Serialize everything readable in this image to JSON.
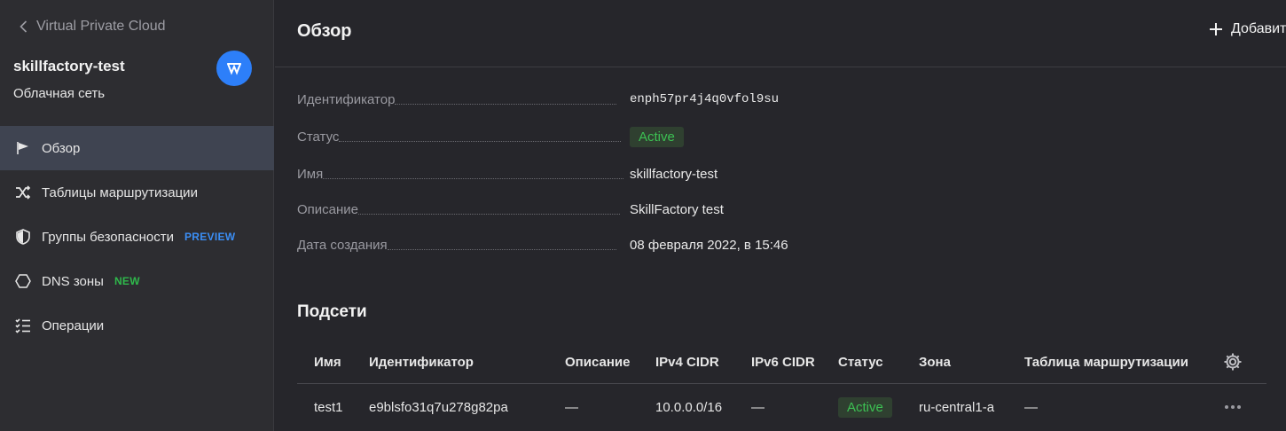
{
  "sidebar": {
    "back_label": "Virtual Private Cloud",
    "project_name": "skillfactory-test",
    "project_subtitle": "Облачная сеть",
    "items": [
      {
        "label": "Обзор",
        "icon": "flag-icon",
        "active": true
      },
      {
        "label": "Таблицы маршрутизации",
        "icon": "shuffle-icon"
      },
      {
        "label": "Группы безопасности",
        "icon": "shield-icon",
        "badge": "PREVIEW"
      },
      {
        "label": "DNS зоны",
        "icon": "hexagon-icon",
        "badge": "NEW"
      },
      {
        "label": "Операции",
        "icon": "checklist-icon"
      }
    ]
  },
  "header": {
    "title": "Обзор",
    "add_label": "Добавить"
  },
  "overview": {
    "id_label": "Идентификатор",
    "id_value": "enph57pr4j4q0vfol9su",
    "status_label": "Статус",
    "status_value": "Active",
    "name_label": "Имя",
    "name_value": "skillfactory-test",
    "desc_label": "Описание",
    "desc_value": "SkillFactory test",
    "created_label": "Дата создания",
    "created_value": "08 февраля 2022, в 15:46"
  },
  "subnets": {
    "title": "Подсети",
    "columns": [
      "Имя",
      "Идентификатор",
      "Описание",
      "IPv4 CIDR",
      "IPv6 CIDR",
      "Статус",
      "Зона",
      "Таблица маршрутизации"
    ],
    "rows": [
      [
        "test1",
        "e9blsfo31q7u278g82pa",
        "—",
        "10.0.0.0/16",
        "—",
        "Active",
        "ru-central1-a",
        "—"
      ]
    ]
  },
  "colors": {
    "accent": "#2d7ff9",
    "active_bg": "#3f4451",
    "status_green": "#3cc153",
    "preview_blue": "#3b8ef5",
    "new_green": "#2fb84b"
  }
}
